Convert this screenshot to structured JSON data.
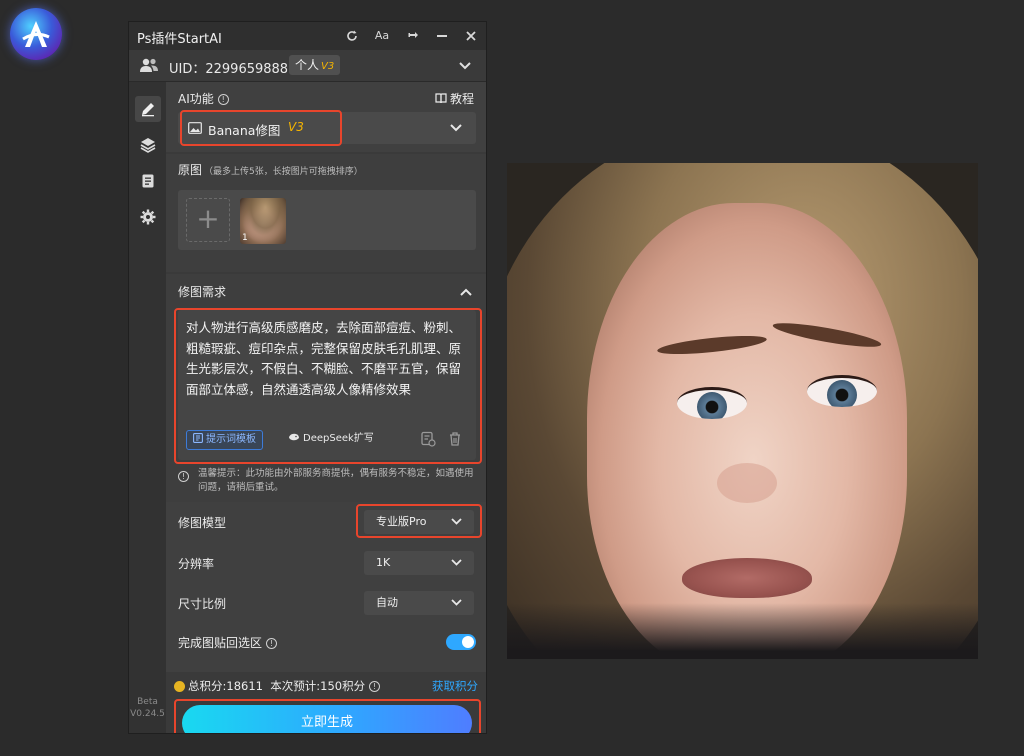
{
  "panel": {
    "title": "Ps插件StartAI",
    "toolbar": {
      "font_label": "Aa"
    }
  },
  "user": {
    "uid": "UID：2299659888",
    "plan": "个人",
    "plan_version": "V3"
  },
  "ai_function": {
    "label": "AI功能",
    "tutorial": "教程",
    "selected": "Banana修图",
    "selected_version": "V3"
  },
  "source_images": {
    "label": "原图",
    "hint": "（最多上传5张，长按图片可拖拽排序）",
    "thumbnails": [
      {
        "index": "1"
      }
    ]
  },
  "edit_request": {
    "label": "修图需求",
    "prompt": "对人物进行高级质感磨皮，去除面部痘痘、粉刺、粗糙瑕疵、痘印杂点，完整保留皮肤毛孔肌理、原生光影层次，不假白、不糊脸、不磨平五官，保留面部立体感，自然通透高级人像精修效果",
    "template_button": "提示词模板",
    "deepseek_button": "DeepSeek扩写",
    "notice": "温馨提示：此功能由外部服务商提供，偶有服务不稳定，如遇使用问题，请稍后重试。"
  },
  "settings": {
    "model_label": "修图模型",
    "model_value": "专业版Pro",
    "resolution_label": "分辨率",
    "resolution_value": "1K",
    "ratio_label": "尺寸比例",
    "ratio_value": "自动",
    "paste_back_label": "完成图贴回选区",
    "paste_back_on": true
  },
  "footer": {
    "total_points": "总积分:18611",
    "estimate": "本次预计:150积分",
    "get_points": "获取积分",
    "generate": "立即生成"
  },
  "sidebar": {
    "version_line1": "Beta",
    "version_line2": "V0.24.5"
  },
  "colors": {
    "accent": "#2ea8ff",
    "highlight": "#e8452c",
    "badge": "#f5b400"
  }
}
